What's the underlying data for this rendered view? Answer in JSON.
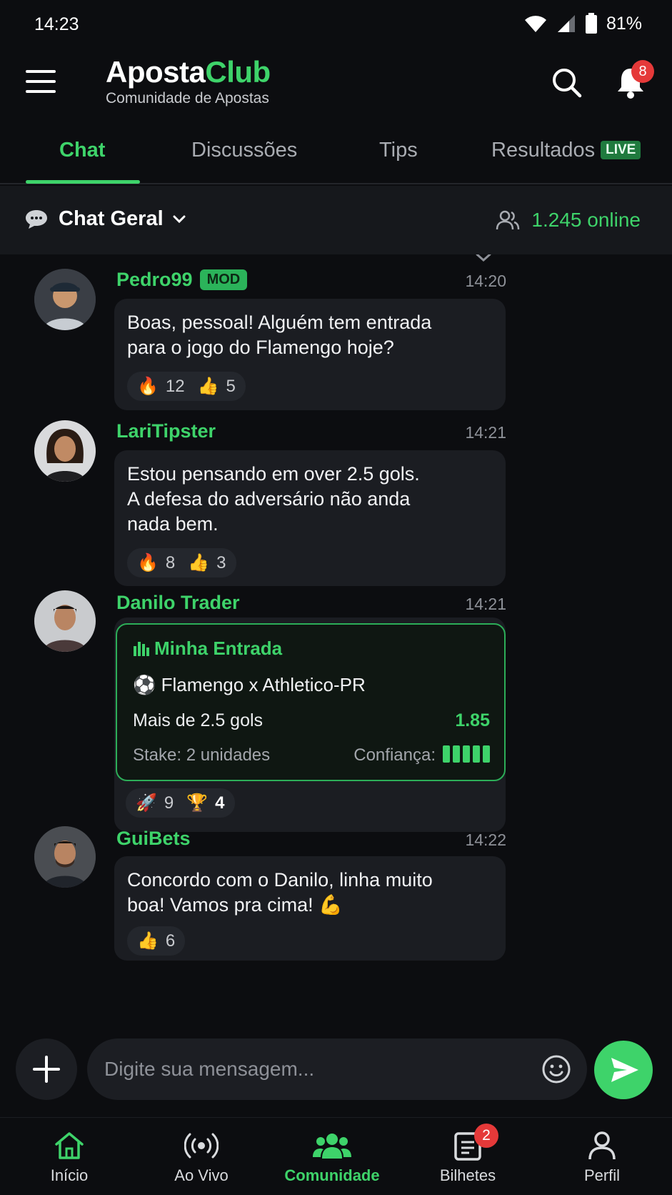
{
  "status_bar": {
    "time": "14:23",
    "battery": "81%"
  },
  "header": {
    "brand_part1": "Aposta",
    "brand_part2": "Club",
    "subtitle": "Comunidade de Apostas",
    "notification_count": "8"
  },
  "tabs": [
    {
      "label": "Chat",
      "active": true
    },
    {
      "label": "Discussões",
      "active": false
    },
    {
      "label": "Tips",
      "active": false
    },
    {
      "label": "Resultados",
      "active": false,
      "badge": "LIVE"
    }
  ],
  "room": {
    "name": "Chat Geral",
    "online": "1.245 online"
  },
  "messages": [
    {
      "user": "Pedro99",
      "badge": "MOD",
      "time": "14:20",
      "lines": [
        "Boas, pessoal! Alguém tem entrada",
        "para o jogo do Flamengo hoje?"
      ],
      "reactions": [
        {
          "icon": "fire-icon",
          "count": "12"
        },
        {
          "icon": "thumbs-up-icon",
          "count": "5"
        }
      ]
    },
    {
      "user": "LariTipster",
      "time": "14:21",
      "lines": [
        "Estou pensando em over 2.5 gols.",
        "A defesa do adversário não anda",
        "nada bem."
      ],
      "reactions": [
        {
          "icon": "fire-icon",
          "count": "8"
        },
        {
          "icon": "thumbs-up-icon",
          "count": "3"
        }
      ]
    },
    {
      "user": "Danilo Trader",
      "time": "14:21",
      "bet_card": {
        "title": "Minha Entrada",
        "match": "Flamengo x Athletico-PR",
        "market": "Mais de 2.5 gols",
        "odd": "1.85",
        "stake": "Stake: 2 unidades",
        "confidence_label": "Confiança:",
        "confidence_level": 5
      },
      "reactions": [
        {
          "icon": "rocket-icon",
          "count": "9"
        },
        {
          "icon": "trophy-icon",
          "count": "4"
        }
      ]
    },
    {
      "user": "GuiBets",
      "time": "14:22",
      "lines": [
        "Concordo com o Danilo, linha muito",
        "boa! Vamos pra cima! 💪"
      ],
      "reactions": [
        {
          "icon": "thumbs-up-icon",
          "count": "6"
        }
      ]
    }
  ],
  "composer": {
    "placeholder": "Digite sua mensagem..."
  },
  "bottom_nav": [
    {
      "label": "Início",
      "icon": "home-icon"
    },
    {
      "label": "Ao Vivo",
      "icon": "broadcast-icon"
    },
    {
      "label": "Comunidade",
      "icon": "community-icon",
      "active": true
    },
    {
      "label": "Bilhetes",
      "icon": "ticket-icon",
      "badge": "2"
    },
    {
      "label": "Perfil",
      "icon": "profile-icon"
    }
  ],
  "colors": {
    "accent": "#3ed36a",
    "background": "#0c0d10",
    "bubble": "#1b1d22",
    "badge": "#e53939"
  }
}
